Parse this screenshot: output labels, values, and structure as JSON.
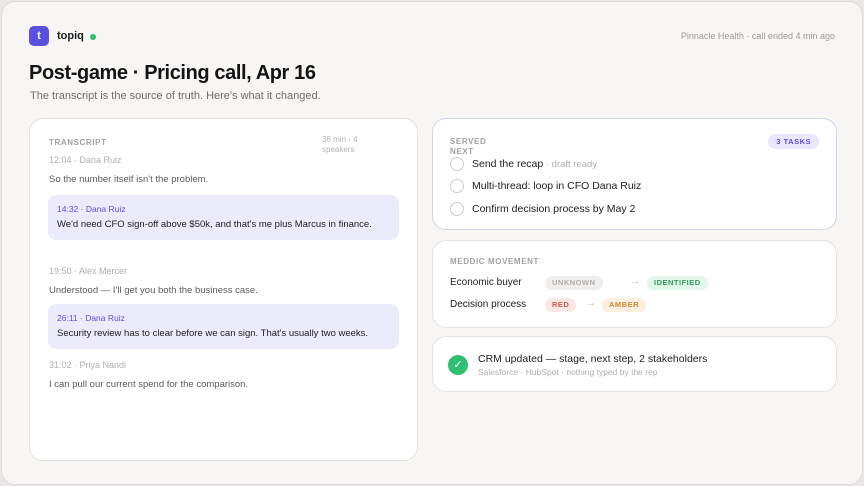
{
  "app": {
    "brand_letter": "t",
    "brand_name": "topiq",
    "call_meta": "Pinnacle Health · call ended 4 min ago"
  },
  "page": {
    "title": "Post-game · Pricing call, Apr 16",
    "subtitle": "The transcript is the source of truth. Here's what it changed."
  },
  "transcript": {
    "label": "TRANSCRIPT",
    "meta": "38 min · 4 speakers",
    "entries": [
      {
        "meta": "12:04 · Dana Ruiz",
        "text": "So the number itself isn't the problem."
      },
      {
        "meta": "14:32 · Dana Ruiz",
        "text": "We'd need CFO sign-off above $50k, and that's me plus Marcus in finance."
      },
      {
        "meta": "19:50 · Alex Mercer",
        "text": "Understood — I'll get you both the business case."
      },
      {
        "meta": "26:11 · Dana Ruiz",
        "text": "Security review has to clear before we can sign. That's usually two weeks."
      },
      {
        "meta": "31:02 · Priya Nandi",
        "text": "I can pull our current spend for the comparison."
      }
    ]
  },
  "served": {
    "label": "SERVED NEXT",
    "badge": "3 TASKS",
    "tasks": [
      {
        "label": "Send the recap",
        "sub": " · draft ready"
      },
      {
        "label": "Multi-thread: loop in CFO Dana Ruiz",
        "sub": ""
      },
      {
        "label": "Confirm decision process by May 2",
        "sub": ""
      }
    ]
  },
  "meddic": {
    "label": "MEDDIC MOVEMENT",
    "arrow": "→",
    "rows": [
      {
        "field": "Economic buyer",
        "from": "UNKNOWN",
        "to": "IDENTIFIED"
      },
      {
        "field": "Decision process",
        "from": "RED",
        "to": "AMBER"
      }
    ]
  },
  "crm": {
    "check": "✓",
    "title": "CRM updated — stage, next step, 2 stakeholders",
    "sub": "Salesforce · HubSpot · nothing typed by the rep"
  }
}
